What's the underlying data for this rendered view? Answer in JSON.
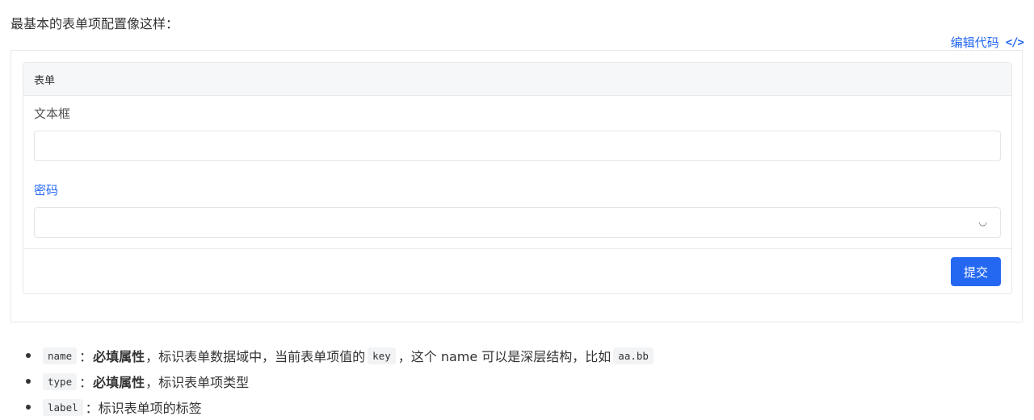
{
  "intro_text": "最基本的表单项配置像这样：",
  "edit_code": {
    "label": "编辑代码",
    "icon_glyph": "</>"
  },
  "form": {
    "title": "表单",
    "fields": [
      {
        "label": "文本框",
        "type": "text",
        "value": ""
      },
      {
        "label": "密码",
        "type": "select",
        "value": ""
      }
    ],
    "submit_label": "提交"
  },
  "notes": [
    {
      "code": "name",
      "sep": "：",
      "bold": "必填属性",
      "text": "，标识表单数据域中，当前表单项值的",
      "code2": "key",
      "text2": "，这个 name 可以是深层结构，比如",
      "code3": "aa.bb"
    },
    {
      "code": "type",
      "sep": "：",
      "bold": "必填属性",
      "text": "，标识表单项类型"
    },
    {
      "code": "label",
      "sep": "：",
      "text": "标识表单项的标签"
    }
  ],
  "colors": {
    "accent": "#2468f2",
    "border": "#e8e9eb",
    "header_bg": "#f6f7f8"
  }
}
